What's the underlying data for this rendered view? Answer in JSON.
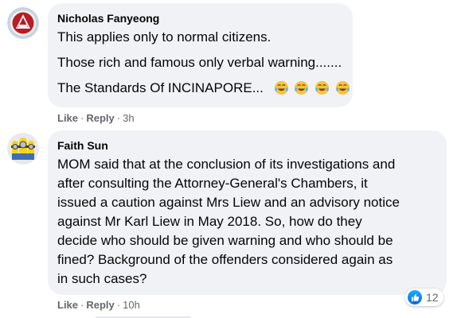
{
  "comments": [
    {
      "author": "Nicholas Fanyeong",
      "lines": [
        "This applies only to normal citizens.",
        "Those rich and famous only verbal warning.......",
        "The Standards Of INCINAPORE..."
      ],
      "emoji_name": "face-with-tears-of-joy-icon",
      "emoji_count": 4,
      "actions": {
        "like": "Like",
        "reply": "Reply",
        "time": "3h"
      }
    },
    {
      "author": "Faith Sun",
      "lines": [
        "MOM said that at the conclusion of its investigations and",
        "after consulting the Attorney-General's Chambers, it",
        "issued a caution against Mrs Liew and an advisory notice",
        "against Mr Karl Liew in May 2018. So, how do they",
        "decide who should be given warning and who should be",
        "fined? Background of the offenders considered again as",
        "in such cases?"
      ],
      "actions": {
        "like": "Like",
        "reply": "Reply",
        "time": "10h"
      },
      "reactions": {
        "icon": "thumbs-up-icon",
        "count": "12"
      }
    }
  ],
  "colors": {
    "bubble": "#f0f2f5",
    "secondary_text": "#65676b",
    "like_blue": "#1877f2"
  }
}
